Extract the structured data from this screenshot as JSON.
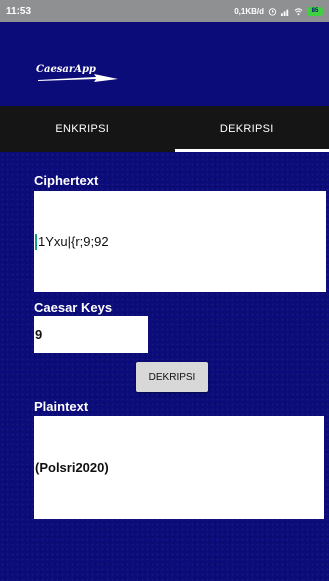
{
  "status_bar": {
    "time": "11:53",
    "network_speed": "0,1KB/d",
    "battery": "85"
  },
  "app": {
    "logo_text": "CaesarApp"
  },
  "tabs": [
    {
      "label": "ENKRIPSI",
      "active": false
    },
    {
      "label": "DEKRIPSI",
      "active": true
    }
  ],
  "ciphertext": {
    "label": "Ciphertext",
    "value": "1Yxu|{r;9;92"
  },
  "keys": {
    "label": "Caesar Keys",
    "value": "9"
  },
  "action": {
    "button_label": "DEKRIPSI"
  },
  "plaintext": {
    "label": "Plaintext",
    "value": "(Polsri2020)"
  },
  "colors": {
    "background": "#0b0b7a",
    "tab_bar": "#151515",
    "status_bar": "#8f9092",
    "cursor": "#16a085"
  }
}
